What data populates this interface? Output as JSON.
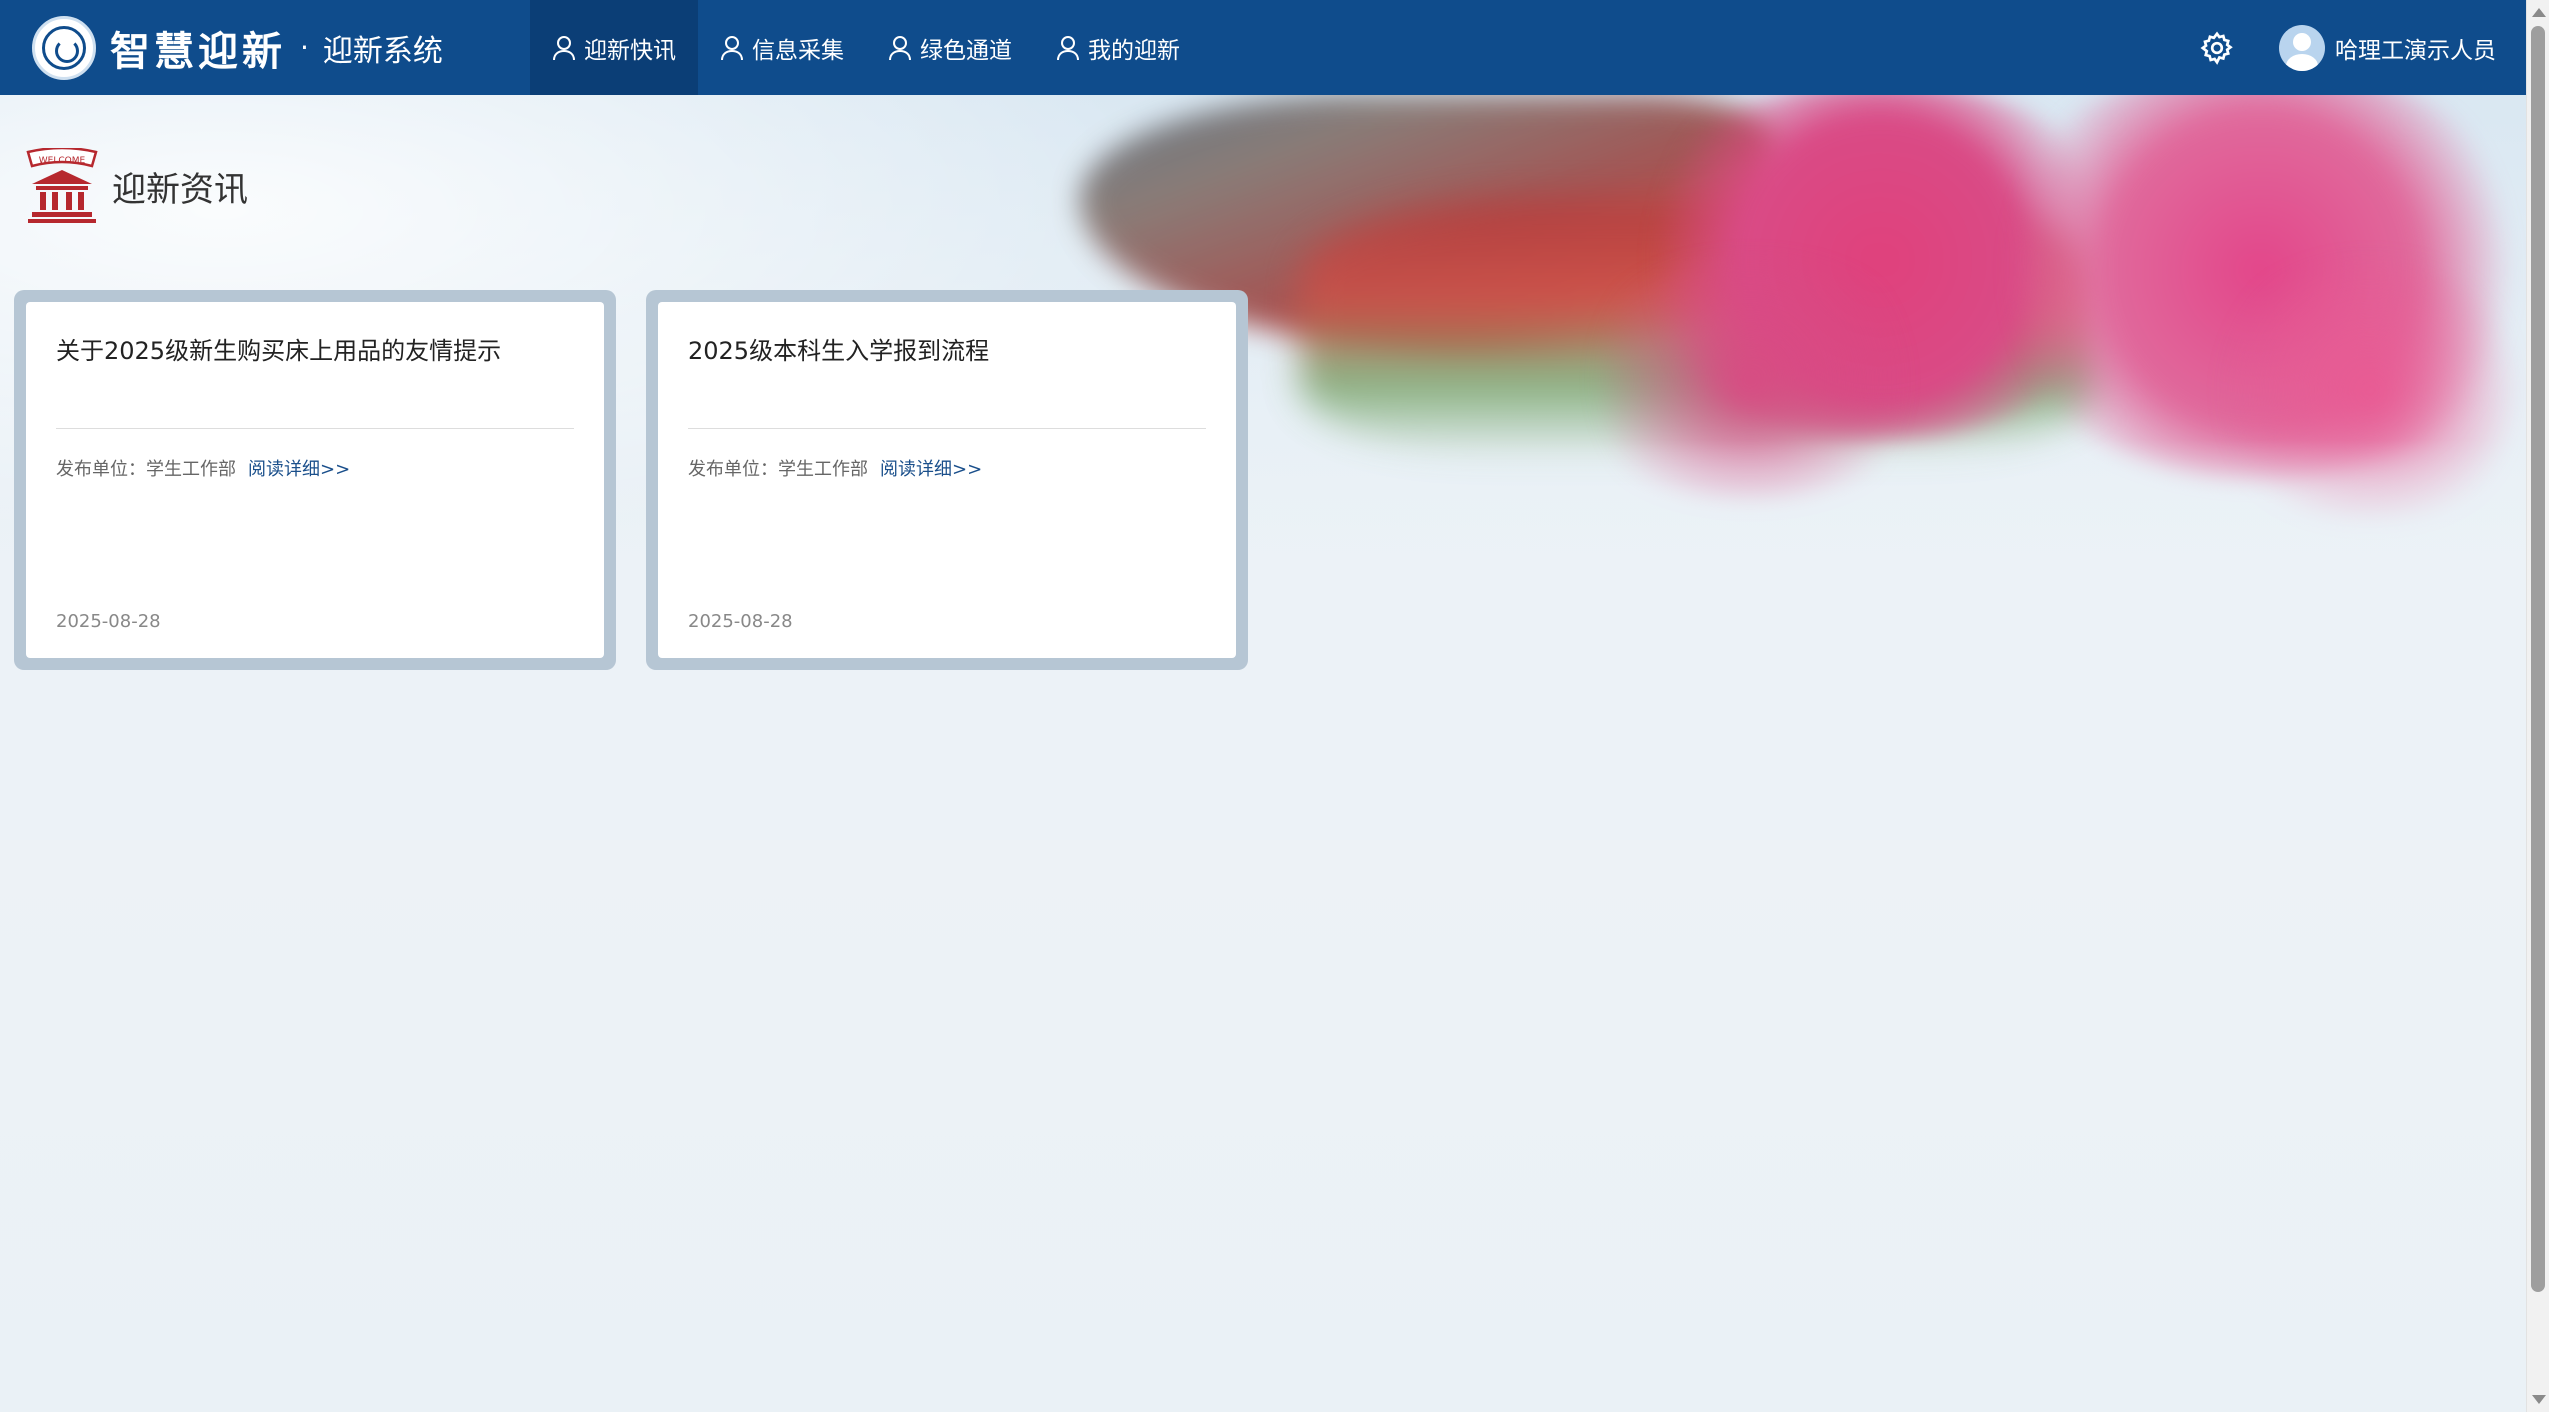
{
  "brand": {
    "title": "智慧迎新",
    "separator": "·",
    "subtitle": "迎新系统",
    "logo_icon": "university-seal-icon"
  },
  "nav": {
    "items": [
      {
        "label": "迎新快讯",
        "icon": "user-icon",
        "active": true
      },
      {
        "label": "信息采集",
        "icon": "user-icon",
        "active": false
      },
      {
        "label": "绿色通道",
        "icon": "user-icon",
        "active": false
      },
      {
        "label": "我的迎新",
        "icon": "user-icon",
        "active": false
      }
    ]
  },
  "user": {
    "name": "哈理工演示人员",
    "settings_icon": "gear-icon",
    "avatar_icon": "avatar-icon"
  },
  "section": {
    "title": "迎新资讯",
    "icon": "welcome-building-icon",
    "icon_text": "WELCOME"
  },
  "cards": [
    {
      "title": "关于2025级新生购买床上用品的友情提示",
      "publisher": "发布单位：学生工作部",
      "read_more": "阅读详细>>",
      "date": "2025-08-28"
    },
    {
      "title": "2025级本科生入学报到流程",
      "publisher": "发布单位：学生工作部",
      "read_more": "阅读详细>>",
      "date": "2025-08-28"
    }
  ],
  "colors": {
    "nav_bg": "#0f4c8c",
    "nav_active_bg": "#0b3e76",
    "link": "#1a4f8b",
    "card_frame": "#b6c6d4",
    "welcome_icon_red": "#b6282e"
  }
}
